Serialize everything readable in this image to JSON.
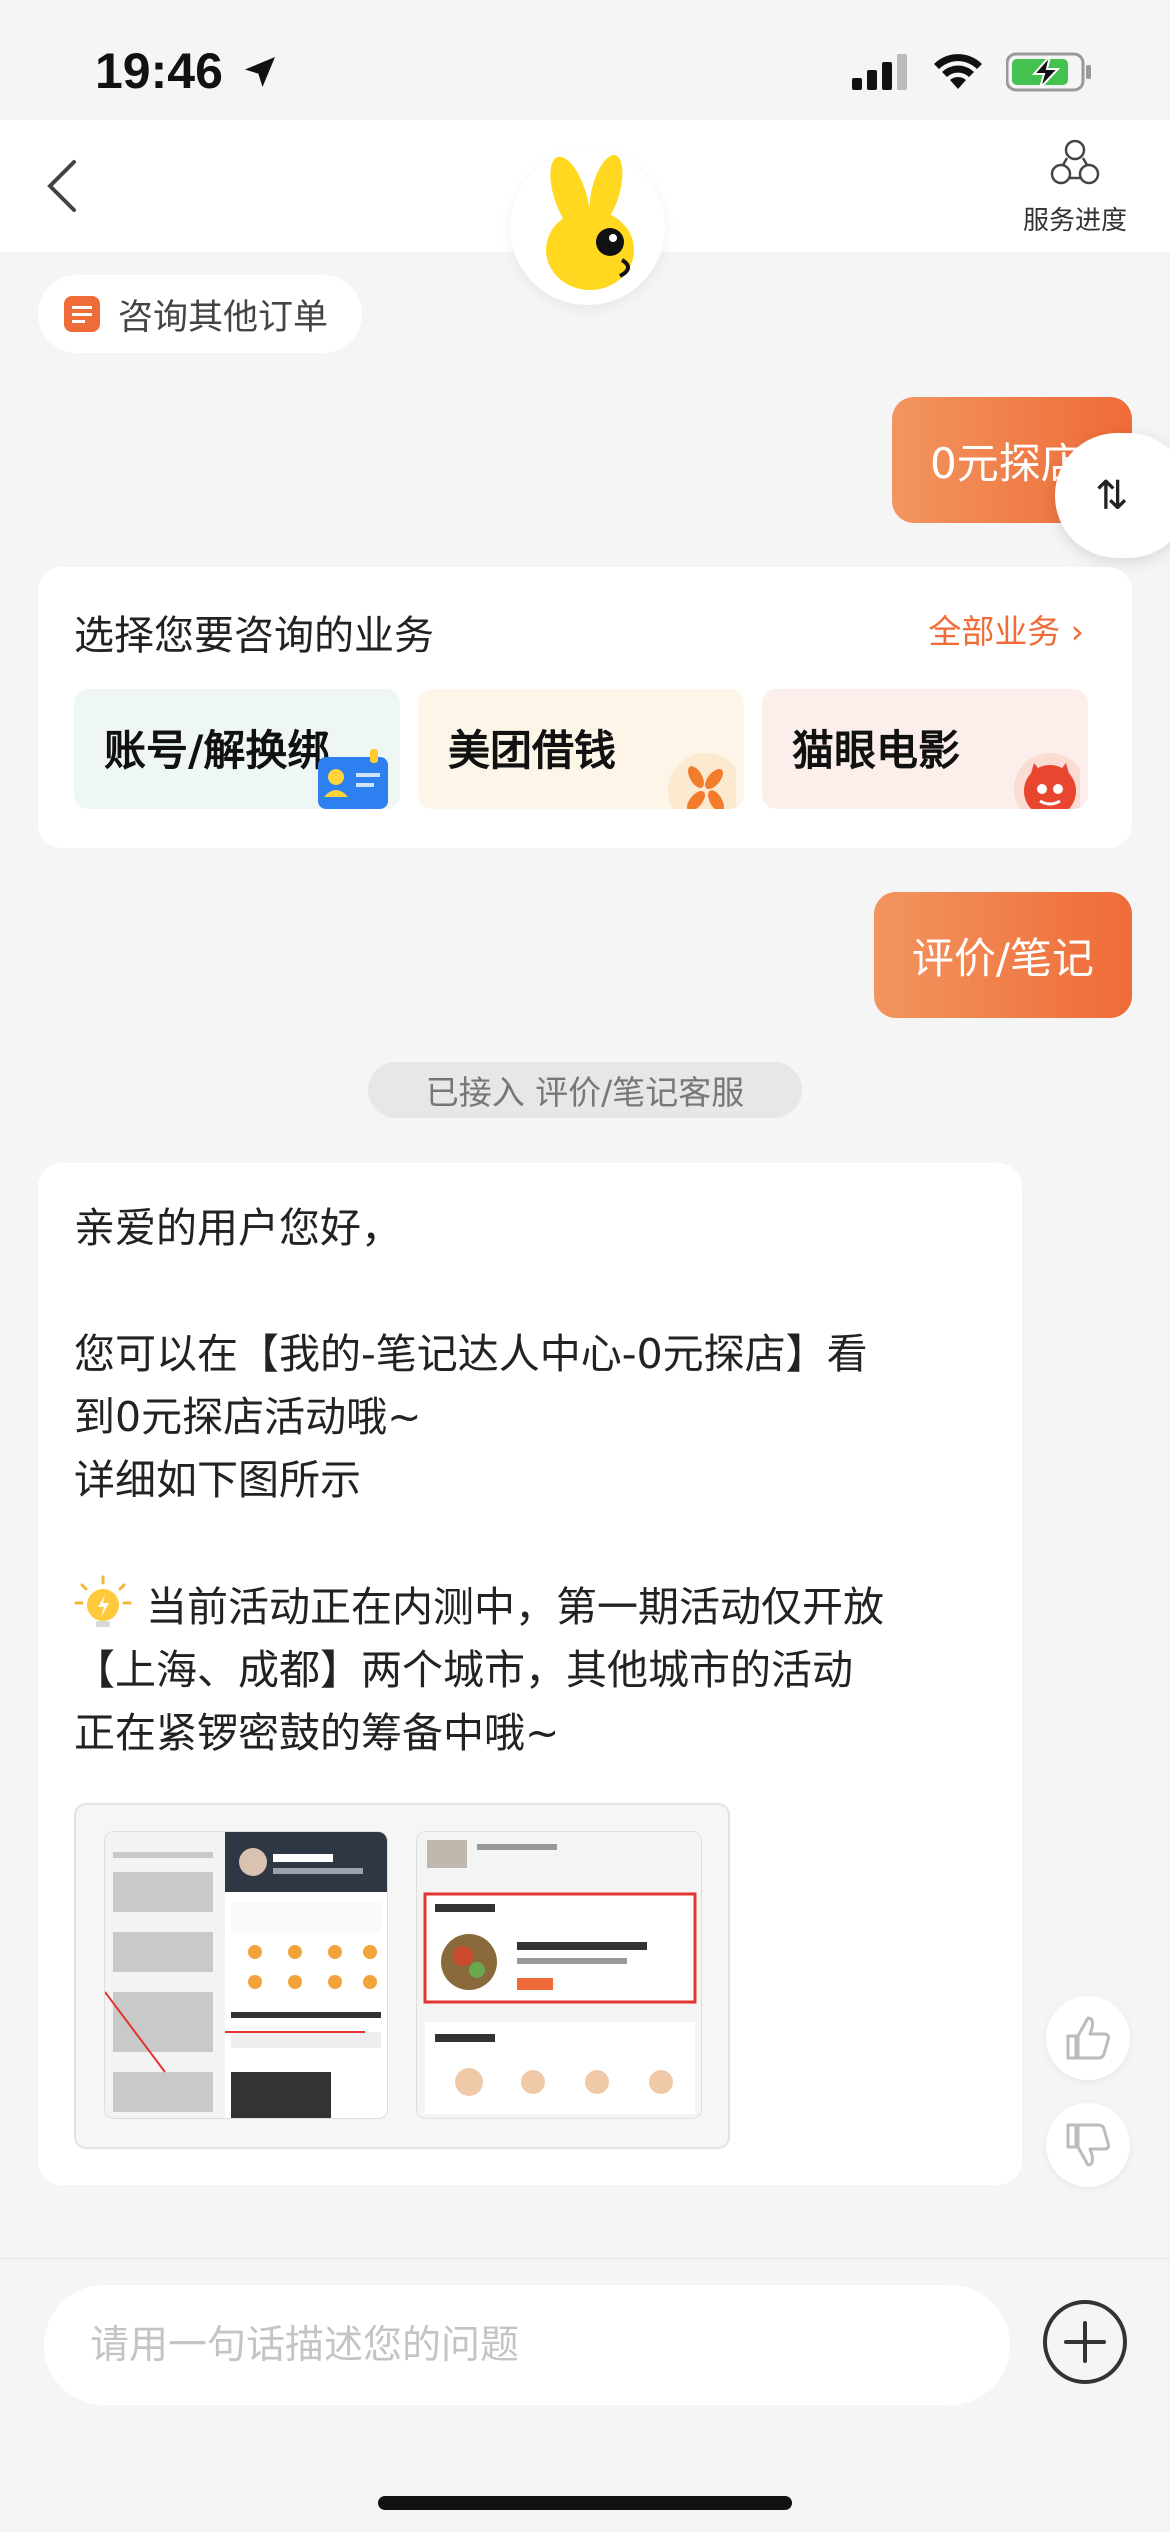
{
  "status_bar": {
    "time": "19:46"
  },
  "nav": {
    "service_progress_label": "服务进度"
  },
  "consult_other_order": "咨询其他订单",
  "messages": {
    "user_1": "0元探店",
    "user_2": "评价/笔记",
    "system_notice": "已接入 评价/笔记客服",
    "agent_lines": [
      "亲爱的用户您好，",
      "您可以在【我的-笔记达人中心-0元探店】看",
      "到0元探店活动哦~",
      "详细如下图所示",
      "当前活动正在内测中，第一期活动仅开放",
      "【上海、成都】两个城市，其他城市的活动",
      "正在紧锣密鼓的筹备中哦~"
    ]
  },
  "business_card": {
    "title": "选择您要咨询的业务",
    "all_link": "全部业务 ›",
    "tiles": [
      {
        "label": "账号/解换绑"
      },
      {
        "label": "美团借钱"
      },
      {
        "label": "猫眼电影"
      }
    ]
  },
  "input": {
    "placeholder": "请用一句话描述您的问题"
  },
  "colors": {
    "accent": "#ef6b37",
    "accent_light": "#f2955f",
    "background": "#f5f5f5"
  }
}
